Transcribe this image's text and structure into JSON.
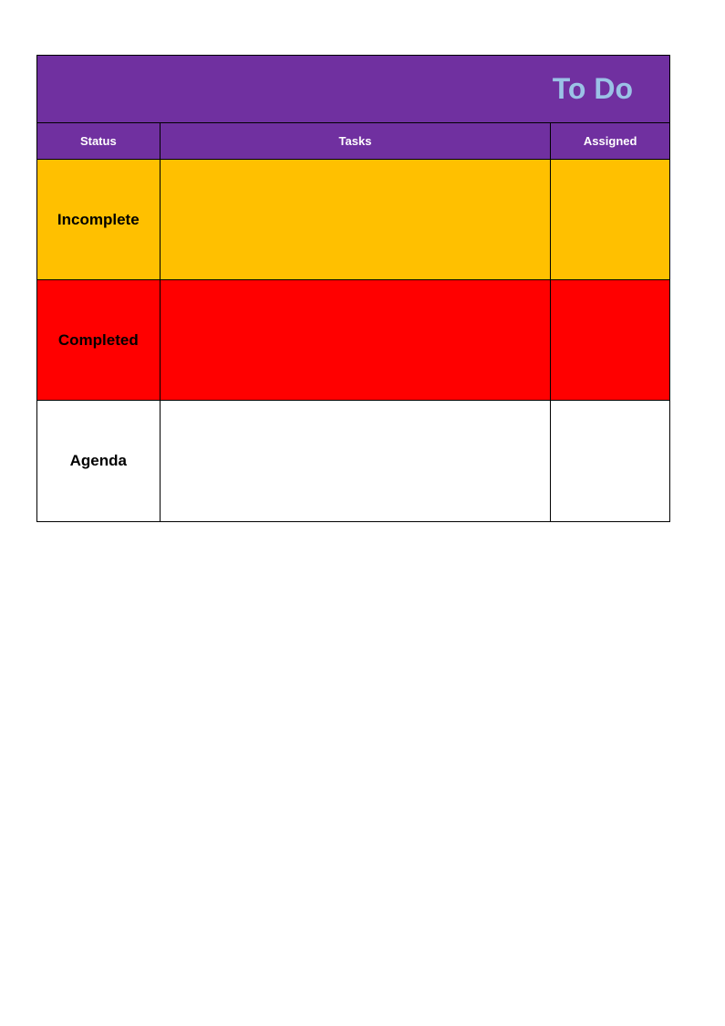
{
  "title": "To Do",
  "headers": {
    "status": "Status",
    "tasks": "Tasks",
    "assigned": "Assigned"
  },
  "rows": [
    {
      "status": "Incomplete",
      "tasks": "",
      "assigned": "",
      "bg": "#ffc000"
    },
    {
      "status": "Completed",
      "tasks": "",
      "assigned": "",
      "bg": "#ff0000"
    },
    {
      "status": "Agenda",
      "tasks": "",
      "assigned": "",
      "bg": "#ffffff"
    }
  ]
}
